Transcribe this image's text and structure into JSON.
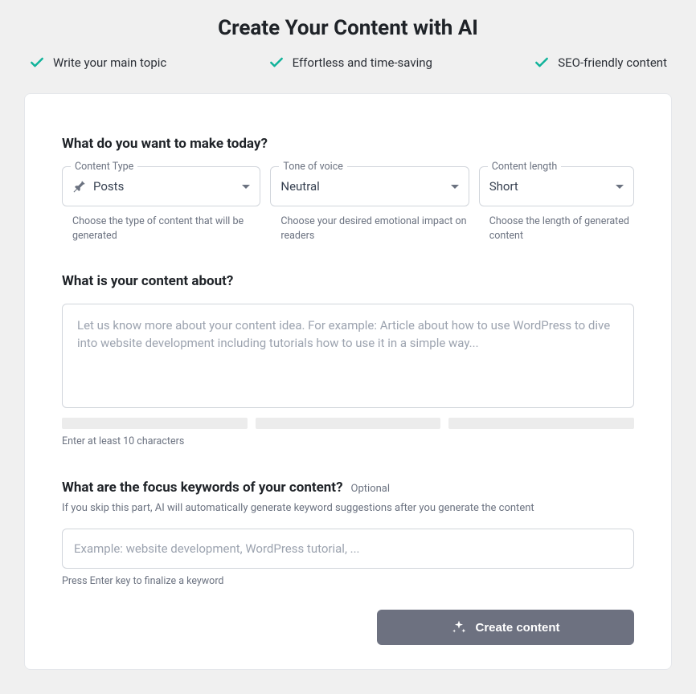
{
  "title": "Create Your Content with AI",
  "features": [
    "Write your main topic",
    "Effortless and time-saving",
    "SEO-friendly content"
  ],
  "section1": {
    "heading": "What do you want to make today?",
    "contentType": {
      "label": "Content Type",
      "value": "Posts",
      "hint": "Choose the type of content that will be generated"
    },
    "tone": {
      "label": "Tone of voice",
      "value": "Neutral",
      "hint": "Choose your desired emotional impact on readers"
    },
    "length": {
      "label": "Content length",
      "value": "Short",
      "hint": "Choose the length of generated content"
    }
  },
  "section2": {
    "heading": "What is your content about?",
    "placeholder": "Let us know more about your content idea. For example: Article about how to use WordPress to dive into website development including tutorials how to use it in a simple way...",
    "hint": "Enter at least 10 characters"
  },
  "section3": {
    "heading": "What are the focus keywords of your content?",
    "optional": "Optional",
    "desc": "If you skip this part, AI will automatically generate keyword suggestions after you generate the content",
    "placeholder": "Example: website development, WordPress tutorial, ...",
    "hint": "Press Enter key to finalize a keyword"
  },
  "button": "Create content"
}
